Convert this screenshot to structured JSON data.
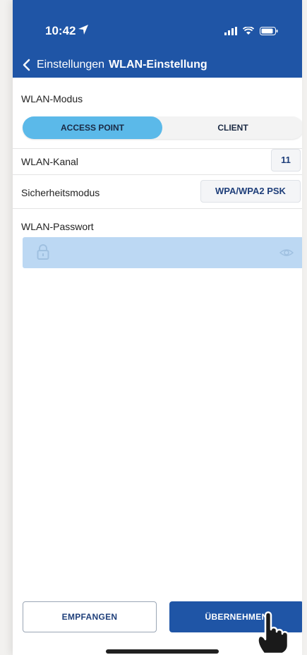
{
  "status_bar": {
    "time": "10:42",
    "icons": [
      "location-arrow-icon",
      "signal-icon",
      "wifi-icon",
      "battery-icon"
    ]
  },
  "nav": {
    "back_label": "Einstellungen",
    "title": "WLAN-Einstellung"
  },
  "wlan_mode": {
    "label": "WLAN-Modus",
    "options": [
      "ACCESS POINT",
      "CLIENT"
    ],
    "selected": "ACCESS POINT"
  },
  "channel": {
    "label": "WLAN-Kanal",
    "value": "11"
  },
  "security": {
    "label": "Sicherheitsmodus",
    "value": "WPA/WPA2 PSK"
  },
  "password": {
    "label": "WLAN-Passwort",
    "value": ""
  },
  "buttons": {
    "receive": "EMPFANGEN",
    "apply": "ÜBERNEHMEN"
  },
  "colors": {
    "header_bg": "#1f55a6",
    "segment_active": "#5bb9e9",
    "password_bg": "#bcd8f3"
  }
}
